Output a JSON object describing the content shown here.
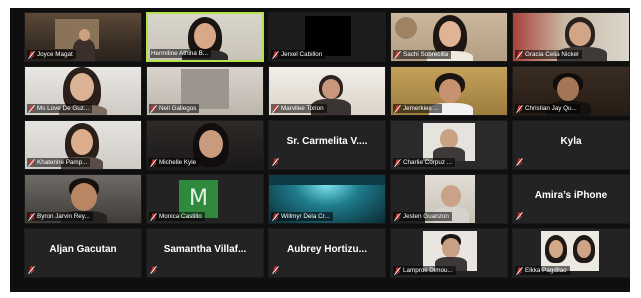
{
  "colors": {
    "background": "#0f0f0f",
    "tile": "#232323",
    "active_speaker_border": "#b5e24a",
    "muted_mic": "#e0302a"
  },
  "icons": {
    "mic": "muted-microphone-icon"
  },
  "participants": [
    {
      "name": "Joyce Magat",
      "muted": true
    },
    {
      "name": "Hermiline Athina B...",
      "muted": false,
      "active_speaker": true
    },
    {
      "name": "Jerxel Cabillon",
      "muted": true
    },
    {
      "name": "Sachi Sobrecilla",
      "muted": true
    },
    {
      "name": "Gracia Celia Nickel",
      "muted": true
    },
    {
      "name": "Ms Love De Guz...",
      "muted": true
    },
    {
      "name": "Neil Gallegos",
      "muted": true
    },
    {
      "name": "Marvilee Torion",
      "muted": true
    },
    {
      "name": "Jemerkies ...",
      "muted": true
    },
    {
      "name": "Christian Jay Qu...",
      "muted": true
    },
    {
      "name": "Khaterine Pamp...",
      "muted": true
    },
    {
      "name": "Michelle Kyle",
      "muted": true
    },
    {
      "name": "Sr. Carmelita V....",
      "muted": true,
      "video_off": true
    },
    {
      "name": "Charlie Corpuz ...",
      "muted": true
    },
    {
      "name": "Kyla",
      "muted": true,
      "video_off": true
    },
    {
      "name": "Byron Jarvin Rey...",
      "muted": true
    },
    {
      "name": "Monica Castillo",
      "muted": true,
      "avatar_letter": "M"
    },
    {
      "name": "Willmyr Dela Cr...",
      "muted": true
    },
    {
      "name": "Jesten Guanzon",
      "muted": true
    },
    {
      "name": "Amira’s iPhone",
      "muted": true,
      "video_off": true
    },
    {
      "name": "Aljan Gacutan",
      "muted": true,
      "video_off": true
    },
    {
      "name": "Samantha Villaf...",
      "muted": true,
      "video_off": true
    },
    {
      "name": "Aubrey Hortizu...",
      "muted": true,
      "video_off": true
    },
    {
      "name": "Lampros Dimou...",
      "muted": true
    },
    {
      "name": "Elkka Pagdilao",
      "muted": true
    }
  ]
}
